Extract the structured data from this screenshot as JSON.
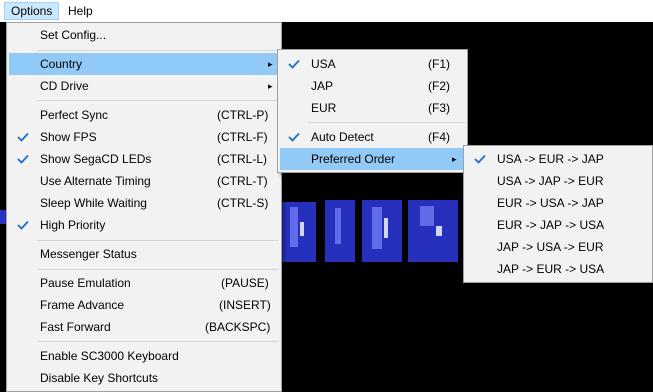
{
  "menubar": {
    "options": "Options",
    "help": "Help"
  },
  "options_menu": {
    "set_config": "Set Config...",
    "country": "Country",
    "cd_drive": "CD Drive",
    "perfect_sync": {
      "label": "Perfect Sync",
      "shortcut": "(CTRL-P)",
      "checked": false
    },
    "show_fps": {
      "label": "Show FPS",
      "shortcut": "(CTRL-F)",
      "checked": true
    },
    "show_segacd_leds": {
      "label": "Show SegaCD LEDs",
      "shortcut": "(CTRL-L)",
      "checked": true
    },
    "alt_timing": {
      "label": "Use Alternate Timing",
      "shortcut": "(CTRL-T)",
      "checked": false
    },
    "sleep_waiting": {
      "label": "Sleep While Waiting",
      "shortcut": "(CTRL-S)",
      "checked": false
    },
    "high_priority": {
      "label": "High Priority",
      "checked": true
    },
    "messenger_status": "Messenger Status",
    "pause_emulation": {
      "label": "Pause Emulation",
      "shortcut": "(PAUSE)"
    },
    "frame_advance": {
      "label": "Frame Advance",
      "shortcut": "(INSERT)"
    },
    "fast_forward": {
      "label": "Fast Forward",
      "shortcut": "(BACKSPC)"
    },
    "enable_sc3000": "Enable SC3000 Keyboard",
    "disable_shortcuts": "Disable Key Shortcuts"
  },
  "country_menu": {
    "usa": {
      "label": "USA",
      "shortcut": "(F1)",
      "checked": true
    },
    "jap": {
      "label": "JAP",
      "shortcut": "(F2)",
      "checked": false
    },
    "eur": {
      "label": "EUR",
      "shortcut": "(F3)",
      "checked": false
    },
    "auto_detect": {
      "label": "Auto Detect",
      "shortcut": "(F4)",
      "checked": true
    },
    "preferred_order": "Preferred Order"
  },
  "order_menu": [
    {
      "label": "USA -> EUR -> JAP",
      "checked": true
    },
    {
      "label": "USA -> JAP -> EUR",
      "checked": false
    },
    {
      "label": "EUR -> USA -> JAP",
      "checked": false
    },
    {
      "label": "EUR -> JAP -> USA",
      "checked": false
    },
    {
      "label": "JAP -> USA -> EUR",
      "checked": false
    },
    {
      "label": "JAP -> EUR -> USA",
      "checked": false
    }
  ],
  "colors": {
    "highlight": "#91c9f7",
    "menu_bg": "#f2f2f2",
    "check": "#1a6fc4",
    "game_blue": "#2a33c8"
  },
  "icons": {
    "check": "checkmark-icon",
    "submenu": "chevron-right-icon"
  }
}
